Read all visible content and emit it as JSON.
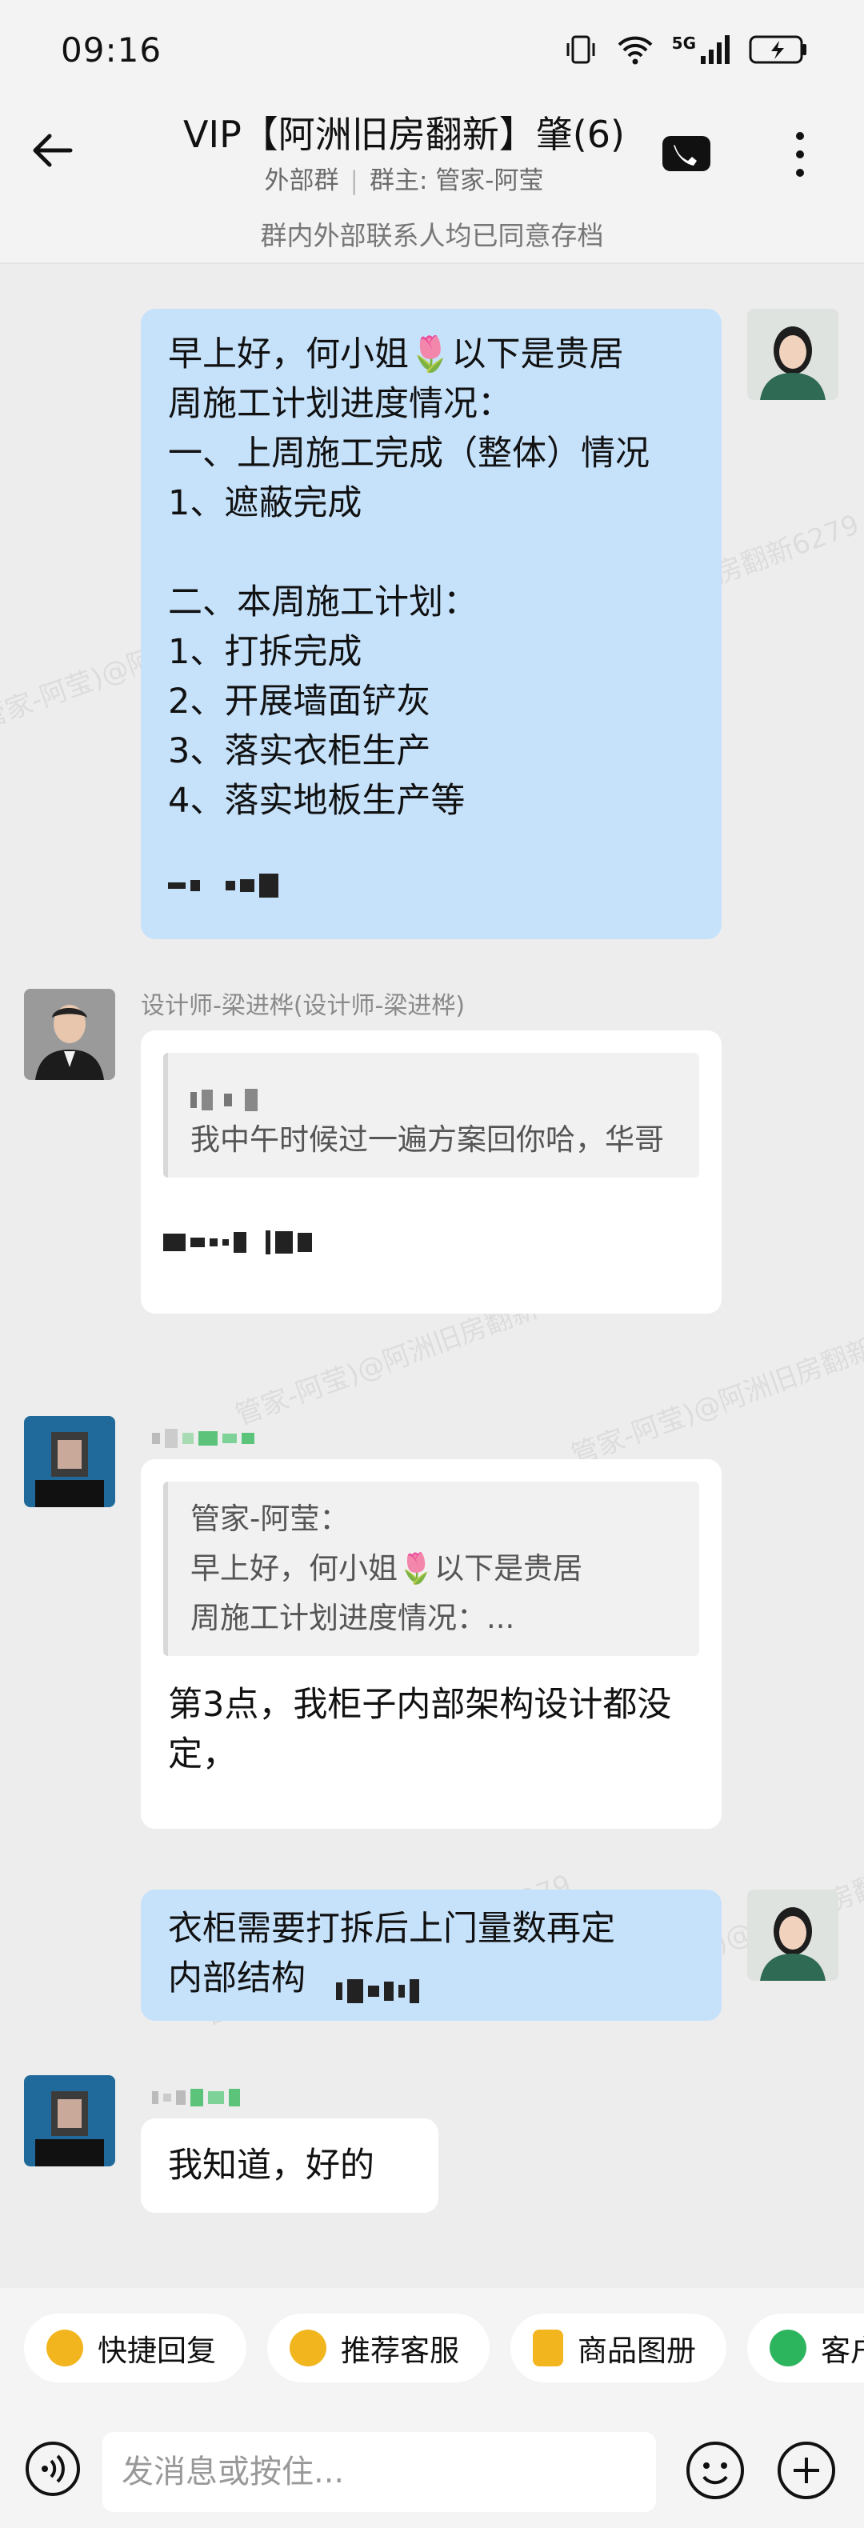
{
  "status_bar": {
    "time": "09:16",
    "network": "5G"
  },
  "header": {
    "title": "VIP【阿洲旧房翻新】肇(6)",
    "subtitle_type": "外部群",
    "subtitle_owner": "群主: 管家-阿莹"
  },
  "notice": "群内外部联系人均已同意存档",
  "watermark": "管家-阿莹)@阿洲旧房翻新6279",
  "messages": {
    "m1": {
      "lines": [
        "早上好，何小姐🌷以下是贵居",
        "周施工计划进度情况：",
        "一、上周施工完成（整体）情况",
        "1、遮蔽完成",
        "",
        "二、本周施工计划：",
        "1、打拆完成",
        "2、开展墙面铲灰",
        "3、落实衣柜生产",
        "4、落实地板生产等"
      ]
    },
    "m2": {
      "sender": "设计师-梁进桦(设计师-梁进桦)",
      "quote_text": "我中午时候过一遍方案回你哈，华哥"
    },
    "m3": {
      "quote_sender": "管家-阿莹：",
      "quote_line1": "早上好，何小姐🌷以下是贵居",
      "quote_line2": "周施工计划进度情况：...",
      "text": "第3点，我柜子内部架构设计都没定，"
    },
    "m4": {
      "line1": "衣柜需要打拆后上门量数再定",
      "line2": "内部结构"
    },
    "m5": {
      "text": "我知道，好的"
    }
  },
  "quick_replies": [
    "快捷回复",
    "推荐客服",
    "商品图册",
    "客户"
  ],
  "input": {
    "placeholder": "发消息或按住..."
  }
}
